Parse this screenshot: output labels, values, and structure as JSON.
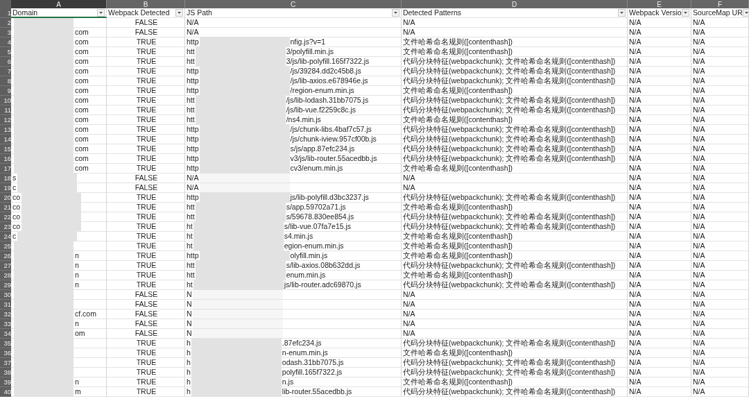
{
  "columns": [
    {
      "letter": "A",
      "header": "Domain",
      "selected": true
    },
    {
      "letter": "B",
      "header": "Webpack Detected",
      "selected": false
    },
    {
      "letter": "C",
      "header": "JS Path",
      "selected": false
    },
    {
      "letter": "D",
      "header": "Detected Patterns",
      "selected": false
    },
    {
      "letter": "E",
      "header": "Webpack Versio",
      "selected": false
    },
    {
      "letter": "F",
      "header": "SourceMap UR",
      "selected": false
    }
  ],
  "header_row": "1",
  "rows": [
    {
      "number": "2",
      "detected": "FALSE",
      "js_start": "N/A",
      "patterns": "N/A",
      "version": "N/A",
      "sourcemap": "N/A"
    },
    {
      "number": "3",
      "domain_end": "com",
      "detected": "FALSE",
      "js_start": "N/A",
      "patterns": "N/A",
      "version": "N/A",
      "sourcemap": "N/A"
    },
    {
      "number": "4",
      "domain_end": "com",
      "detected": "TRUE",
      "js_start": "http",
      "js_end": "nfig.js?v=1",
      "patterns": "文件哈希命名规则([contenthash])",
      "version": "N/A",
      "sourcemap": "N/A"
    },
    {
      "number": "5",
      "domain_end": "com",
      "detected": "TRUE",
      "js_start": "htt",
      "js_end": "3/polyfill.min.js",
      "patterns": "文件哈希命名规则([contenthash])",
      "version": "N/A",
      "sourcemap": "N/A"
    },
    {
      "number": "6",
      "domain_end": "com",
      "detected": "TRUE",
      "js_start": "htt",
      "js_end": "3/js/lib-polyfill.165f7322.js",
      "patterns": "代码分块特征(webpackchunk); 文件哈希命名规则([contenthash])",
      "version": "N/A",
      "sourcemap": "N/A"
    },
    {
      "number": "7",
      "domain_end": "com",
      "detected": "TRUE",
      "js_start": "http",
      "js_end": "/js/39284.dd2c45b8.js",
      "patterns": "代码分块特征(webpackchunk); 文件哈希命名规则([contenthash])",
      "version": "N/A",
      "sourcemap": "N/A"
    },
    {
      "number": "8",
      "domain_end": "com",
      "detected": "TRUE",
      "js_start": "http",
      "js_end": "/js/lib-axios.e678946e.js",
      "patterns": "代码分块特征(webpackchunk); 文件哈希命名规则([contenthash])",
      "version": "N/A",
      "sourcemap": "N/A"
    },
    {
      "number": "9",
      "domain_end": "com",
      "detected": "TRUE",
      "js_start": "http",
      "js_end": "/region-enum.min.js",
      "patterns": "文件哈希命名规则([contenthash])",
      "version": "N/A",
      "sourcemap": "N/A"
    },
    {
      "number": "10",
      "domain_end": "com",
      "detected": "TRUE",
      "js_start": "htt",
      "js_end": "/js/lib-lodash.31bb7075.js",
      "patterns": "代码分块特征(webpackchunk); 文件哈希命名规则([contenthash])",
      "version": "N/A",
      "sourcemap": "N/A"
    },
    {
      "number": "11",
      "domain_end": "com",
      "detected": "TRUE",
      "js_start": "htt",
      "js_end": "/js/lib-vue.f2259c8c.js",
      "patterns": "代码分块特征(webpackchunk); 文件哈希命名规则([contenthash])",
      "version": "N/A",
      "sourcemap": "N/A"
    },
    {
      "number": "12",
      "domain_end": "com",
      "detected": "TRUE",
      "js_start": "htt",
      "js_end": "/ns4.min.js",
      "patterns": "文件哈希命名规则([contenthash])",
      "version": "N/A",
      "sourcemap": "N/A"
    },
    {
      "number": "13",
      "domain_end": "com",
      "detected": "TRUE",
      "js_start": "http",
      "js_end": "/js/chunk-libs.4baf7c57.js",
      "patterns": "代码分块特征(webpackchunk); 文件哈希命名规则([contenthash])",
      "version": "N/A",
      "sourcemap": "N/A"
    },
    {
      "number": "14",
      "domain_end": "com",
      "detected": "TRUE",
      "js_start": "http",
      "js_end": "/js/chunk-iview.957cf00b.js",
      "patterns": "代码分块特征(webpackchunk); 文件哈希命名规则([contenthash])",
      "version": "N/A",
      "sourcemap": "N/A"
    },
    {
      "number": "15",
      "domain_end": "com",
      "detected": "TRUE",
      "js_start": "http",
      "js_end": "s/js/app.87efc234.js",
      "patterns": "代码分块特征(webpackchunk); 文件哈希命名规则([contenthash])",
      "version": "N/A",
      "sourcemap": "N/A"
    },
    {
      "number": "16",
      "domain_end": "com",
      "detected": "TRUE",
      "js_start": "http",
      "js_end": "v3/js/lib-router.55acedbb.js",
      "patterns": "代码分块特征(webpackchunk); 文件哈希命名规则([contenthash])",
      "version": "N/A",
      "sourcemap": "N/A"
    },
    {
      "number": "17",
      "domain_end": "com",
      "detected": "TRUE",
      "js_start": "http",
      "js_end": "cv3/enum.min.js",
      "patterns": "文件哈希命名规则([contenthash])",
      "version": "N/A",
      "sourcemap": "N/A"
    },
    {
      "number": "18",
      "domain_start": "s",
      "detected": "FALSE",
      "js_start": "N/A",
      "patterns": "N/A",
      "version": "N/A",
      "sourcemap": "N/A"
    },
    {
      "number": "19",
      "domain_start": "c",
      "detected": "FALSE",
      "js_start": "N/A",
      "patterns": "N/A",
      "version": "N/A",
      "sourcemap": "N/A"
    },
    {
      "number": "20",
      "domain_start": "co",
      "detected": "TRUE",
      "js_start": "http",
      "js_end": "js/lib-polyfill.d3bc3237.js",
      "patterns": "代码分块特征(webpackchunk); 文件哈希命名规则([contenthash])",
      "version": "N/A",
      "sourcemap": "N/A"
    },
    {
      "number": "21",
      "domain_start": "co",
      "detected": "TRUE",
      "js_start": "htt",
      "js_end": "s/app.59702a71.js",
      "patterns": "文件哈希命名规则([contenthash])",
      "version": "N/A",
      "sourcemap": "N/A"
    },
    {
      "number": "22",
      "domain_start": "co",
      "detected": "TRUE",
      "js_start": "htt",
      "js_end": "s/59678.830ee854.js",
      "patterns": "代码分块特征(webpackchunk); 文件哈希命名规则([contenthash])",
      "version": "N/A",
      "sourcemap": "N/A"
    },
    {
      "number": "23",
      "domain_start": "co",
      "detected": "TRUE",
      "js_start": "ht",
      "js_end": "s/lib-vue.07fa7e15.js",
      "patterns": "代码分块特征(webpackchunk); 文件哈希命名规则([contenthash])",
      "version": "N/A",
      "sourcemap": "N/A"
    },
    {
      "number": "24",
      "domain_start": "c",
      "detected": "TRUE",
      "js_start": "ht",
      "js_end": "s4.min.js",
      "patterns": "文件哈希命名规则([contenthash])",
      "version": "N/A",
      "sourcemap": "N/A"
    },
    {
      "number": "25",
      "detected": "TRUE",
      "js_start": "ht",
      "js_end": "egion-enum.min.js",
      "patterns": "文件哈希命名规则([contenthash])",
      "version": "N/A",
      "sourcemap": "N/A"
    },
    {
      "number": "26",
      "domain_end": "n",
      "detected": "TRUE",
      "js_start": "http",
      "js_end": "olyfill.min.js",
      "patterns": "文件哈希命名规则([contenthash])",
      "version": "N/A",
      "sourcemap": "N/A"
    },
    {
      "number": "27",
      "domain_end": "n",
      "detected": "TRUE",
      "js_start": "htt",
      "js_end": "s/lib-axios.08b632dd.js",
      "patterns": "代码分块特征(webpackchunk); 文件哈希命名规则([contenthash])",
      "version": "N/A",
      "sourcemap": "N/A"
    },
    {
      "number": "28",
      "domain_end": "n",
      "detected": "TRUE",
      "js_start": "htt",
      "js_end": "enum.min.js",
      "patterns": "文件哈希命名规则([contenthash])",
      "version": "N/A",
      "sourcemap": "N/A"
    },
    {
      "number": "29",
      "domain_end": "n",
      "detected": "TRUE",
      "js_start": "ht",
      "js_end": "js/lib-router.adc69870.js",
      "patterns": "代码分块特征(webpackchunk); 文件哈希命名规则([contenthash])",
      "version": "N/A",
      "sourcemap": "N/A"
    },
    {
      "number": "30",
      "detected": "FALSE",
      "js_start": "N",
      "patterns": "N/A",
      "version": "N/A",
      "sourcemap": "N/A"
    },
    {
      "number": "31",
      "detected": "FALSE",
      "js_start": "N",
      "patterns": "N/A",
      "version": "N/A",
      "sourcemap": "N/A"
    },
    {
      "number": "32",
      "domain_end": "cf.com",
      "detected": "FALSE",
      "js_start": "N",
      "patterns": "N/A",
      "version": "N/A",
      "sourcemap": "N/A"
    },
    {
      "number": "33",
      "domain_end": "n",
      "detected": "FALSE",
      "js_start": "N",
      "patterns": "N/A",
      "version": "N/A",
      "sourcemap": "N/A"
    },
    {
      "number": "34",
      "domain_end": "om",
      "detected": "FALSE",
      "js_start": "N",
      "patterns": "N/A",
      "version": "N/A",
      "sourcemap": "N/A"
    },
    {
      "number": "35",
      "detected": "TRUE",
      "js_start": "h",
      "js_end": ".87efc234.js",
      "patterns": "代码分块特征(webpackchunk); 文件哈希命名规则([contenthash])",
      "version": "N/A",
      "sourcemap": "N/A"
    },
    {
      "number": "36",
      "detected": "TRUE",
      "js_start": "h",
      "js_end": "n-enum.min.js",
      "patterns": "文件哈希命名规则([contenthash])",
      "version": "N/A",
      "sourcemap": "N/A"
    },
    {
      "number": "37",
      "detected": "TRUE",
      "js_start": "h",
      "js_end": "odash.31bb7075.js",
      "patterns": "代码分块特征(webpackchunk); 文件哈希命名规则([contenthash])",
      "version": "N/A",
      "sourcemap": "N/A"
    },
    {
      "number": "38",
      "detected": "TRUE",
      "js_start": "h",
      "js_end": "polyfill.165f7322.js",
      "patterns": "代码分块特征(webpackchunk); 文件哈希命名规则([contenthash])",
      "version": "N/A",
      "sourcemap": "N/A"
    },
    {
      "number": "39",
      "domain_end": "n",
      "detected": "TRUE",
      "js_start": "h",
      "js_end": "n.js",
      "patterns": "文件哈希命名规则([contenthash])",
      "version": "N/A",
      "sourcemap": "N/A"
    },
    {
      "number": "40",
      "domain_end": "m",
      "detected": "TRUE",
      "js_start": "h",
      "js_end": "lib-router.55acedbb.js",
      "patterns": "代码分块特征(webpackchunk); 文件哈希命名规则([contenthash])",
      "version": "N/A",
      "sourcemap": "N/A"
    }
  ]
}
